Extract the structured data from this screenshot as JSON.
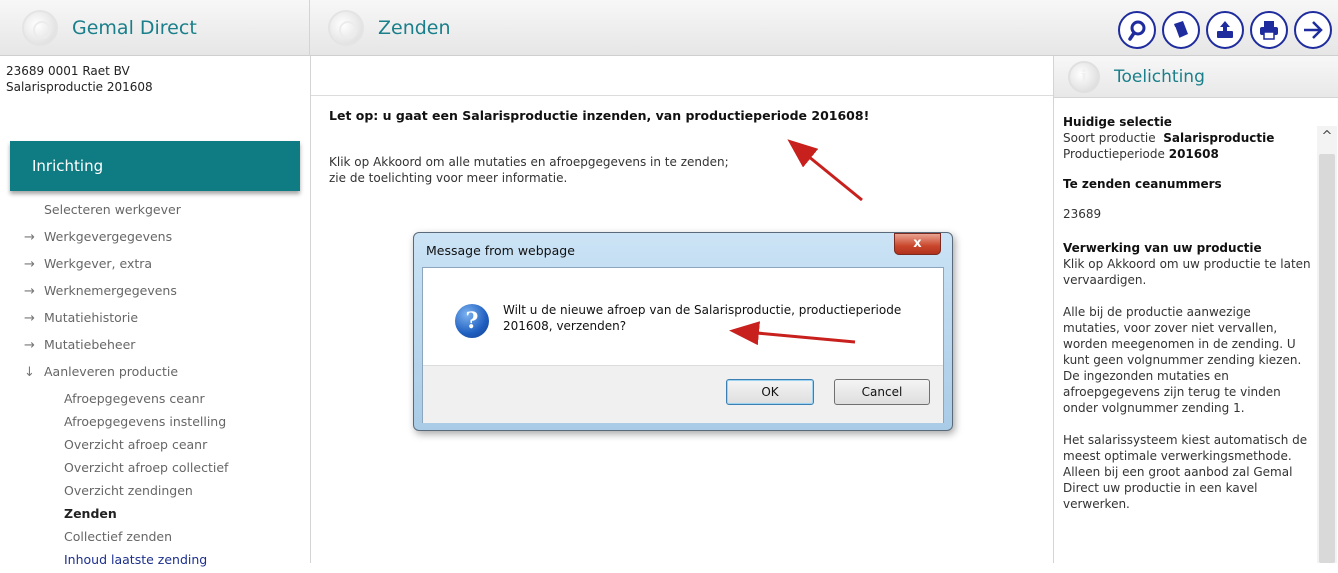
{
  "topbar": {
    "app_title": "Gemal Direct",
    "page_title": "Zenden",
    "tools": [
      {
        "icon": "search-icon"
      },
      {
        "icon": "book-icon"
      },
      {
        "icon": "upload-icon"
      },
      {
        "icon": "printer-icon"
      },
      {
        "icon": "arrow-right-icon"
      }
    ]
  },
  "sidebar": {
    "company_line1": "23689 0001 Raet BV",
    "company_line2": "Salarisproductie  201608",
    "section_title": "Inrichting",
    "items": [
      {
        "label": "Selecteren werkgever"
      },
      {
        "label": "Werkgevergegevens",
        "arrow": "→"
      },
      {
        "label": "Werkgever, extra",
        "arrow": "→"
      },
      {
        "label": "Werknemergegevens",
        "arrow": "→"
      },
      {
        "label": "Mutatiehistorie",
        "arrow": "→"
      },
      {
        "label": "Mutatiebeheer",
        "arrow": "→"
      },
      {
        "label": "Aanleveren productie",
        "arrow": "↓"
      }
    ],
    "subitems": [
      {
        "label": "Afroepgegevens ceanr"
      },
      {
        "label": "Afroepgegevens instelling"
      },
      {
        "label": "Overzicht afroep ceanr"
      },
      {
        "label": "Overzicht afroep collectief"
      },
      {
        "label": "Overzicht zendingen"
      },
      {
        "label": "Zenden"
      },
      {
        "label": "Collectief zenden"
      },
      {
        "label": "Inhoud laatste zending"
      }
    ]
  },
  "main": {
    "warning": "Let op: u gaat een Salarisproductie inzenden, van productieperiode 201608!",
    "info_line1": "Klik op Akkoord om alle mutaties en afroepgegevens in te zenden;",
    "info_line2": "zie de toelichting voor meer informatie."
  },
  "dialog": {
    "title": "Message from webpage",
    "close": "x",
    "message_line1": "Wilt u de nieuwe afroep van de Salarisproductie, productieperiode",
    "message_line2": "201608, verzenden?",
    "ok_label": "OK",
    "cancel_label": "Cancel",
    "icon": "question-icon"
  },
  "panel": {
    "title": "Toelichting",
    "sel_heading": "Huidige selectie",
    "sel_type_label": "Soort productie",
    "sel_type_value": "Salarisproductie",
    "sel_period_label": "Productieperiode",
    "sel_period_value": "201608",
    "ceanr_heading": "Te zenden ceanummers",
    "ceanr_value": "23689",
    "proc_heading": "Verwerking van uw productie",
    "proc_text": "Klik op Akkoord om uw productie te laten vervaardigen.",
    "para2": "Alle bij de productie aanwezige mutaties, voor zover niet vervallen, worden meegenomen in de zending. U kunt geen volgnummer zending kiezen. De ingezonden mutaties en afroepgegevens zijn terug te vinden onder volgnummer zending 1.",
    "para3": "Het salarissysteem kiest automatisch de meest optimale verwerkingsmethode. Alleen bij een groot aanbod zal Gemal Direct uw productie in een kavel verwerken."
  },
  "colors": {
    "accent": "#1a7f8a",
    "section_bg": "#0f7b82",
    "tool_border": "#1e2c9e",
    "annotation_arrow": "#c8201c"
  }
}
